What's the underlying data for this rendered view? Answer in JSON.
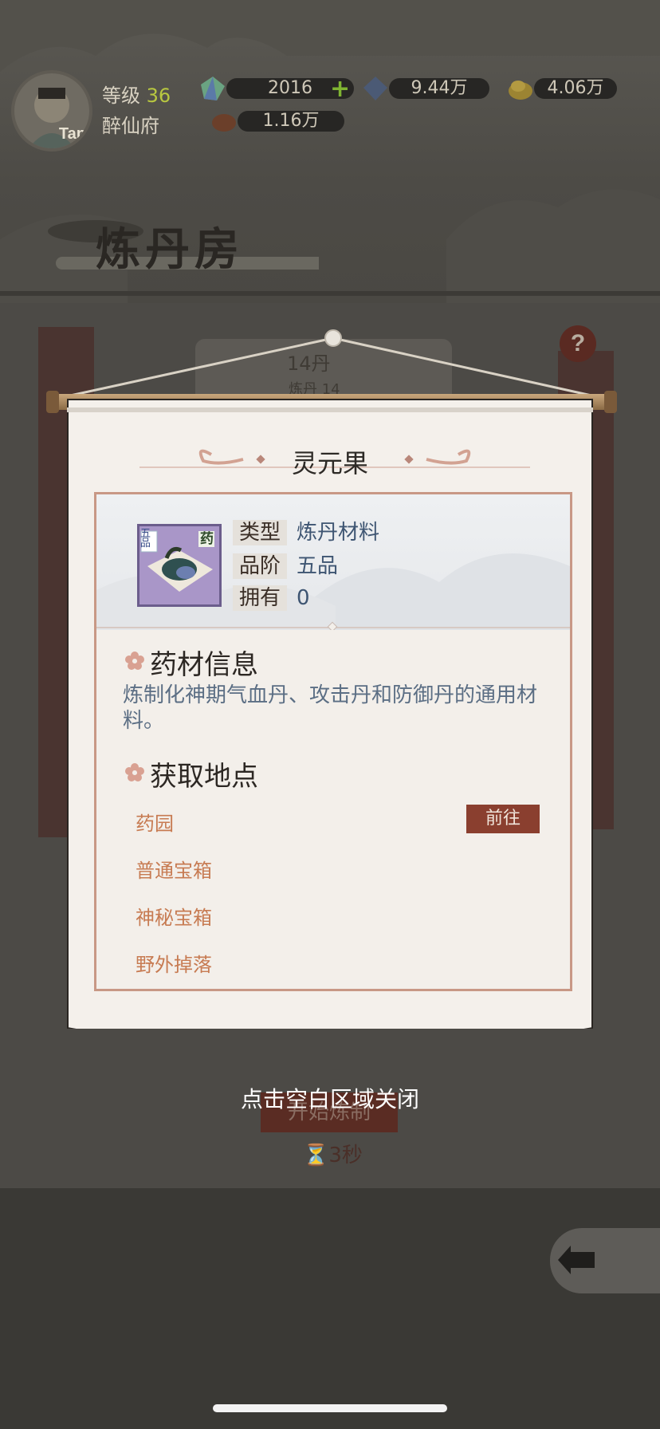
{
  "player": {
    "level_label": "等级",
    "level_value": "36",
    "house_name": "醉仙府",
    "avatar_badge": "Tap"
  },
  "resources": {
    "spirit_stone": "2016",
    "crystal": "9.44万",
    "gold": "4.06万",
    "food": "1.16万",
    "plus_symbol": "+"
  },
  "page": {
    "title": "炼丹房",
    "help_symbol": "?",
    "recipe_name": "14丹",
    "recipe_sub": "炼丹 14",
    "start_label": "开始炼制",
    "timer": "3秒"
  },
  "modal": {
    "title": "灵元果",
    "item_badge_left": "五品",
    "item_badge_right": "药",
    "attributes": [
      {
        "key": "类型",
        "value": "炼丹材料"
      },
      {
        "key": "品阶",
        "value": "五品"
      },
      {
        "key": "拥有",
        "value": "0"
      }
    ],
    "info_title": "药材信息",
    "description": "炼制化神期气血丹、攻击丹和防御丹的通用材料。",
    "source_title": "获取地点",
    "sources": [
      {
        "name": "药园",
        "action": "前往"
      },
      {
        "name": "普通宝箱"
      },
      {
        "name": "神秘宝箱"
      },
      {
        "name": "野外掉落"
      }
    ],
    "close_hint": "点击空白区域关闭"
  },
  "colors": {
    "accent_red": "#8a3f2f",
    "location_text": "#c77b52",
    "description_text": "#5b6e84",
    "border_pink": "#c89885"
  }
}
